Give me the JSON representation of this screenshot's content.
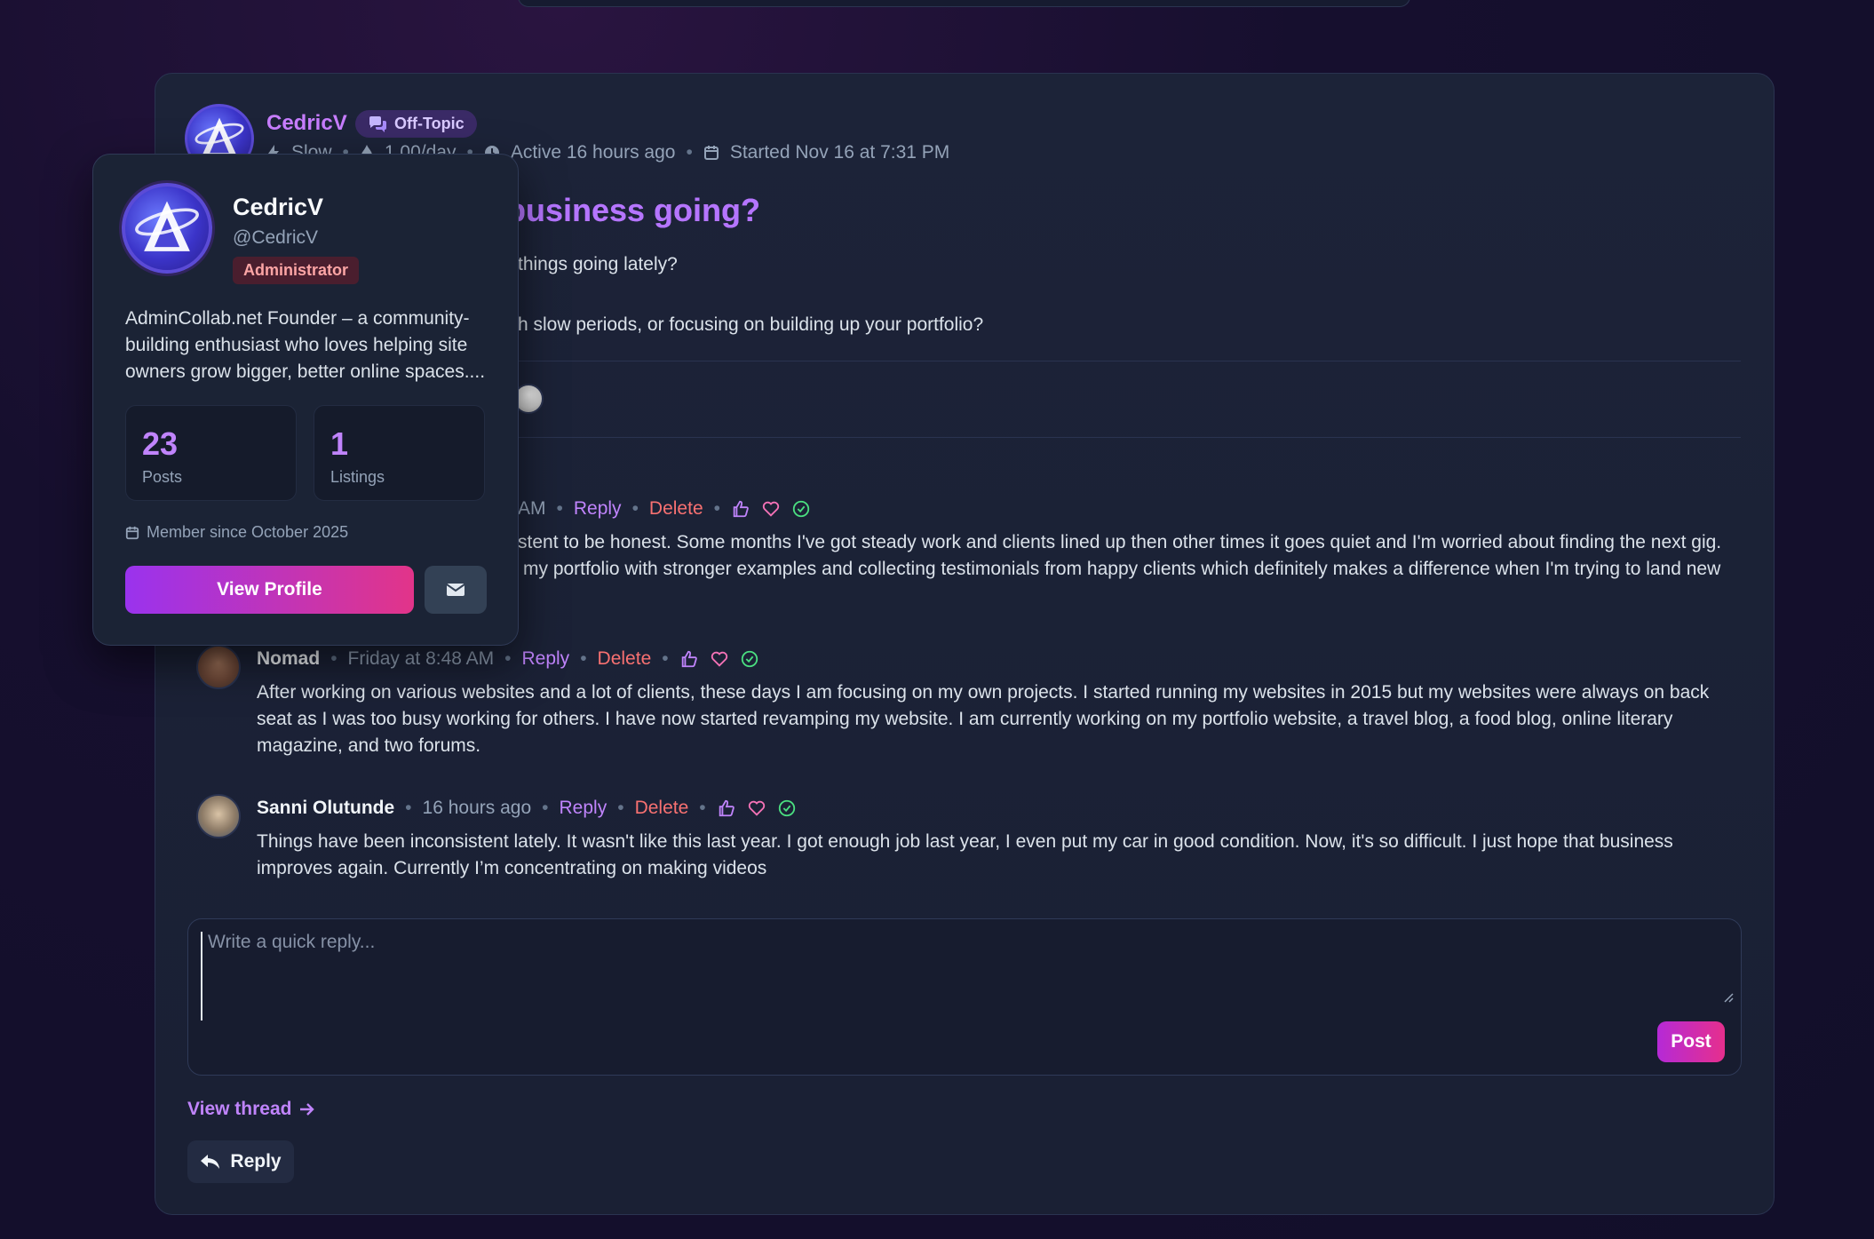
{
  "thread": {
    "author": "CedricV",
    "category": "Off-Topic",
    "meta_1": "Slow",
    "meta_2": "1.00/day",
    "active": "Active 16 hours ago",
    "started": "Started Nov 16 at 7:31 PM",
    "title_visible": "business going?",
    "body_line_1": "things going lately?",
    "body_line_2": "h slow periods, or focusing on building up your portfolio?"
  },
  "comments": [
    {
      "name": "",
      "time": "AM",
      "reply_label": "Reply",
      "delete_label": "Delete",
      "line_1": "stent to be honest. Some months I've got steady work and clients lined up then other times it goes quiet and I'm worried about finding the next gig.",
      "line_2": "my portfolio with stronger examples and collecting testimonials from happy clients which definitely makes a difference when I'm trying to land new"
    },
    {
      "name": "Nomad",
      "time": "Friday at 8:48 AM",
      "reply_label": "Reply",
      "delete_label": "Delete",
      "text": "After working on various websites and a lot of clients, these days I am focusing on my own projects. I started running my websites in 2015 but my websites were always on back seat as I was too busy working for others. I have now started revamping my website. I am currently working on my portfolio website, a travel blog, a food blog, online literary magazine, and two forums."
    },
    {
      "name": "Sanni Olutunde",
      "time": "16 hours ago",
      "reply_label": "Reply",
      "delete_label": "Delete",
      "text": "Things have been inconsistent lately. It wasn't like this last year. I got enough job last year, I even put my car in good condition. Now, it's so difficult. I just hope that business improves again. Currently I’m concentrating on making videos"
    }
  ],
  "reply_box": {
    "placeholder": "Write a quick reply...",
    "post_label": "Post"
  },
  "footer": {
    "view_thread": "View thread",
    "reply_label": "Reply"
  },
  "popover": {
    "name": "CedricV",
    "handle": "@CedricV",
    "role": "Administrator",
    "bio": "AdminCollab.net Founder – a community-building enthusiast who loves helping site owners grow bigger, better online spaces....",
    "posts_value": "23",
    "posts_label": "Posts",
    "listings_value": "1",
    "listings_label": "Listings",
    "member_since": "Member since October 2025",
    "view_profile": "View Profile"
  },
  "colors": {
    "accent": "#c084fc",
    "danger": "#f87171",
    "success": "#4ade80"
  }
}
